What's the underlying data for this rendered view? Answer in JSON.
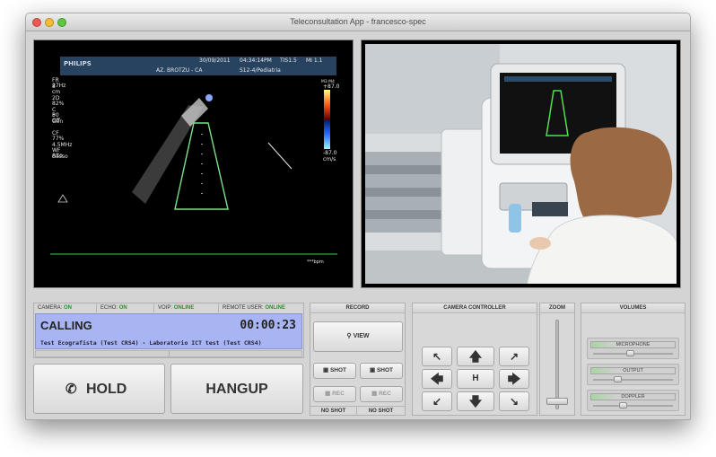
{
  "window": {
    "title": "Teleconsultation App - francesco-spec",
    "traffic_lights": {
      "close": "#ee5a52",
      "minimize": "#f5bd2f",
      "maximize": "#5fc63f"
    }
  },
  "ultrasound": {
    "brand": "PHILIPS",
    "date": "30/09/2011",
    "time": "04:34:14PM",
    "tis": "TIS1.5",
    "mi": "MI 1.1",
    "facility": "AZ. BROTZU - CA",
    "probe": "S12-4/Pediatria",
    "left_info": [
      "FR 27Hz",
      "8 cm",
      "",
      "2D",
      "82%",
      "C 50",
      "P Off",
      "Gen",
      "",
      "CF",
      "77%",
      "4.5MHz",
      "WF Alto",
      "Basso"
    ],
    "scale_top": "+87.0",
    "scale_bottom": "-87.0",
    "scale_unit": "cm/s",
    "scale_mode": "M3 M4",
    "bpm": "***bpm"
  },
  "status": {
    "camera_label": "CAMERA:",
    "camera_value": "ON",
    "echo_label": "ECHO:",
    "echo_value": "ON",
    "voip_label": "VOIP:",
    "voip_value": "ONLINE",
    "remote_label": "REMOTE USER:",
    "remote_value": "ONLINE"
  },
  "call": {
    "state": "CALLING",
    "timer": "00:00:23",
    "participants": "Test Ecografista (Test CRS4) - Laboratorio ICT test (Test CRS4)",
    "hold_label": "HOLD",
    "hangup_label": "HANGUP"
  },
  "record": {
    "header": "RECORD",
    "view_label": "VIEW",
    "shot_label_1": "SHOT",
    "shot_label_2": "SHOT",
    "rec_label_1": "REC",
    "rec_label_2": "REC",
    "no_shot_1": "NO SHOT",
    "no_shot_2": "NO SHOT"
  },
  "camera_controller": {
    "header": "CAMERA CONTROLLER",
    "home_label": "H",
    "arrows": {
      "up_left": "↖",
      "up": "🡅",
      "up_right": "↗",
      "left": "🡄",
      "right": "🡆",
      "down_left": "↙",
      "down": "🡇",
      "down_right": "↘"
    }
  },
  "zoom": {
    "header": "ZOOM",
    "level": 0.05
  },
  "volumes": {
    "header": "VOLUMES",
    "sliders": [
      {
        "label": "MICROPHONE",
        "level": 0.45
      },
      {
        "label": "OUTPUT",
        "level": 0.28
      },
      {
        "label": "DOPPLER",
        "level": 0.35
      }
    ]
  }
}
